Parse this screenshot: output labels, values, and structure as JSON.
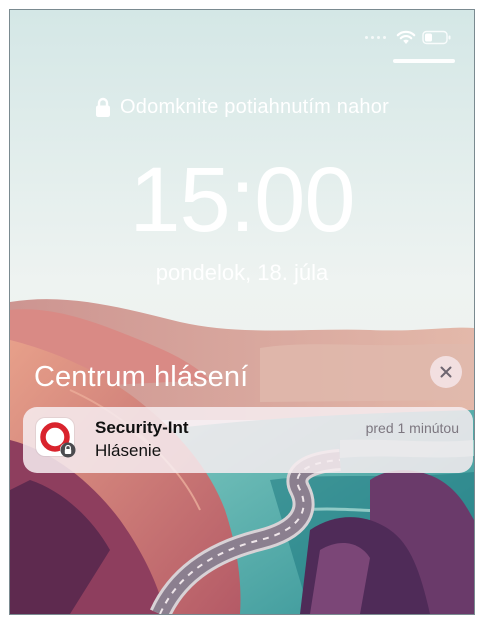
{
  "status_bar": {
    "signal": "weak",
    "wifi_icon": "wifi-icon",
    "battery_icon": "battery-icon",
    "battery_level": 0.35
  },
  "lock_screen": {
    "unlock_hint": "Odomknite potiahnutím nahor",
    "lock_icon": "lock-icon",
    "time": "15:00",
    "date": "pondelok, 18. júla"
  },
  "notification_center": {
    "title": "Centrum hlásení",
    "close_icon": "close-icon"
  },
  "notifications": [
    {
      "app": "Security-Int",
      "time": "pred 1 minútou",
      "body": "Hlásenie",
      "icon": "security-int-app-icon",
      "badge_icon": "lock-badge-icon"
    }
  ],
  "colors": {
    "sky": "#e9f0ef",
    "sea_teal": "#54b8b4",
    "cliff_pink": "#e38a78",
    "cliff_dark": "#5a2f56",
    "app_red": "#d9232d"
  }
}
